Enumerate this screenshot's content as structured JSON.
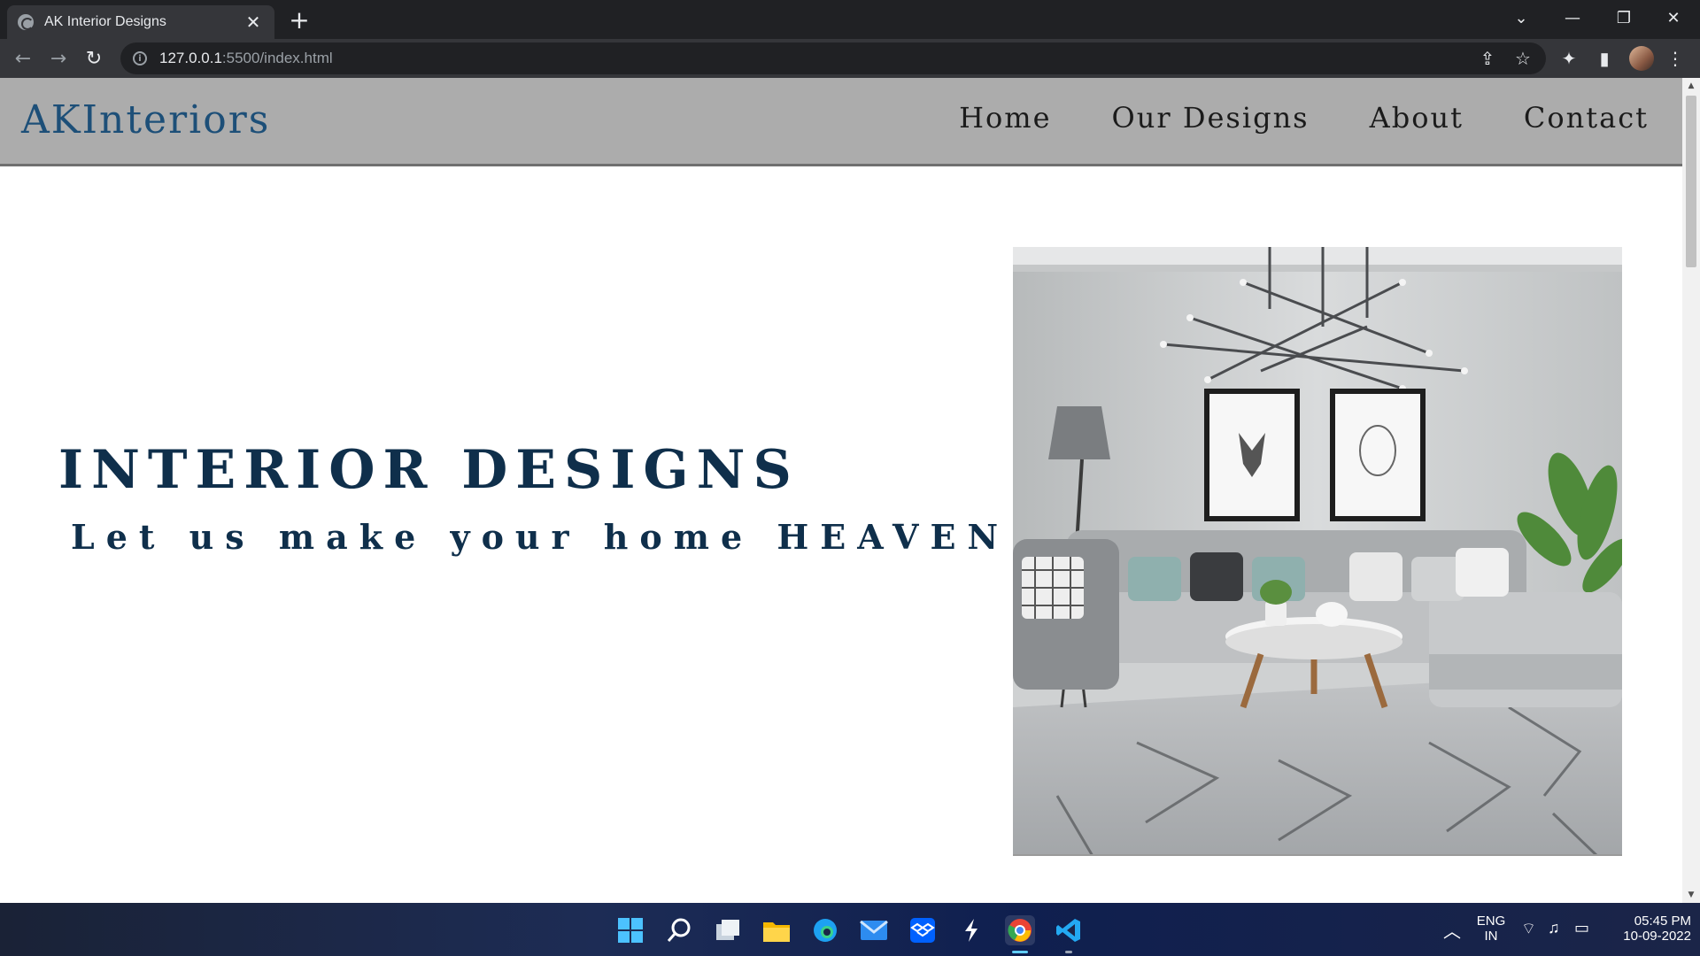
{
  "browser": {
    "tab_title": "AK Interior Designs",
    "tab_close": "✕",
    "new_tab": "+",
    "url_host": "127.0.0.1",
    "url_path": ":5500/index.html"
  },
  "site": {
    "brand_ak": "AK",
    "brand_rest": "Interiors",
    "nav": [
      {
        "label": "Home"
      },
      {
        "label": "Our Designs"
      },
      {
        "label": "About"
      },
      {
        "label": "Contact"
      }
    ],
    "hero_title": "INTERIOR DESIGNS",
    "hero_subtitle": "Let us make your home HEAVEN"
  },
  "taskbar": {
    "language": "ENG",
    "region": "IN",
    "time": "05:45 PM",
    "date": "10-09-2022"
  },
  "colors": {
    "brand": "#1d4f78",
    "hero_text": "#0f2f4b",
    "navbar_bg": "#acacac"
  }
}
